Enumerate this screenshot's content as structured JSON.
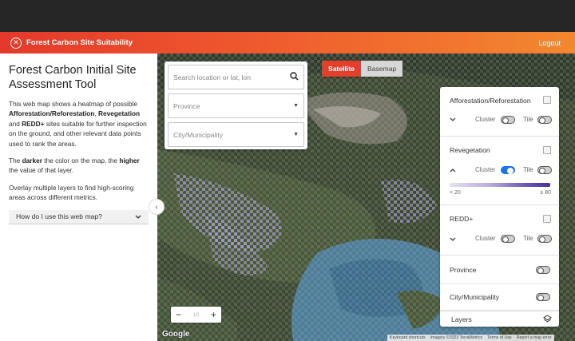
{
  "header": {
    "app_title": "Forest Carbon Site Suitability",
    "logout_label": "Logout"
  },
  "sidebar": {
    "title": "Forest Carbon Initial Site Assessment Tool",
    "p1_a": "This web map shows a heatmap of possible ",
    "p1_b1": "Afforestation/Reforestation",
    "p1_c": ", ",
    "p1_b2": "Revegetation",
    "p1_d": " and ",
    "p1_b3": "REDD+",
    "p1_e": " sites suitable for further inspection on the ground, and other relevant data points used to rank the areas.",
    "p2_a": "The ",
    "p2_b1": "darker",
    "p2_c": " the color on the map, the ",
    "p2_b2": "higher",
    "p2_d": " the value of that layer.",
    "p3": "Overlay multiple layers to find high-scoring areas across different metrics.",
    "howto_label": "How do I use this web map?"
  },
  "search": {
    "placeholder": "Search location or lat, lon",
    "province": "Province",
    "city": "City/Municipality"
  },
  "map_type": {
    "satellite": "Satellite",
    "basemap": "Basemap",
    "selected": "Satellite"
  },
  "layers": {
    "afforestation": {
      "label": "Afforestation/Reforestation",
      "cluster": "Cluster",
      "tile": "Tile",
      "cluster_on": false,
      "tile_on": false,
      "expanded": false
    },
    "revegetation": {
      "label": "Revegetation",
      "cluster": "Cluster",
      "tile": "Tile",
      "cluster_on": true,
      "tile_on": false,
      "expanded": true,
      "legend_low": "< 20",
      "legend_high": "≥ 80"
    },
    "redd": {
      "label": "REDD+",
      "cluster": "Cluster",
      "tile": "Tile",
      "cluster_on": false,
      "tile_on": false,
      "expanded": false
    },
    "province": {
      "label": "Province",
      "on": false
    },
    "city": {
      "label": "City/Municipality",
      "on": false
    },
    "footer": "Layers"
  },
  "zoom": {
    "level": "10"
  },
  "attribution": {
    "google": "Google",
    "shortcuts": "Keyboard shortcuts",
    "imagery": "Imagery ©2023 TerraMetrics",
    "terms": "Terms of Use",
    "report": "Report a map error"
  }
}
